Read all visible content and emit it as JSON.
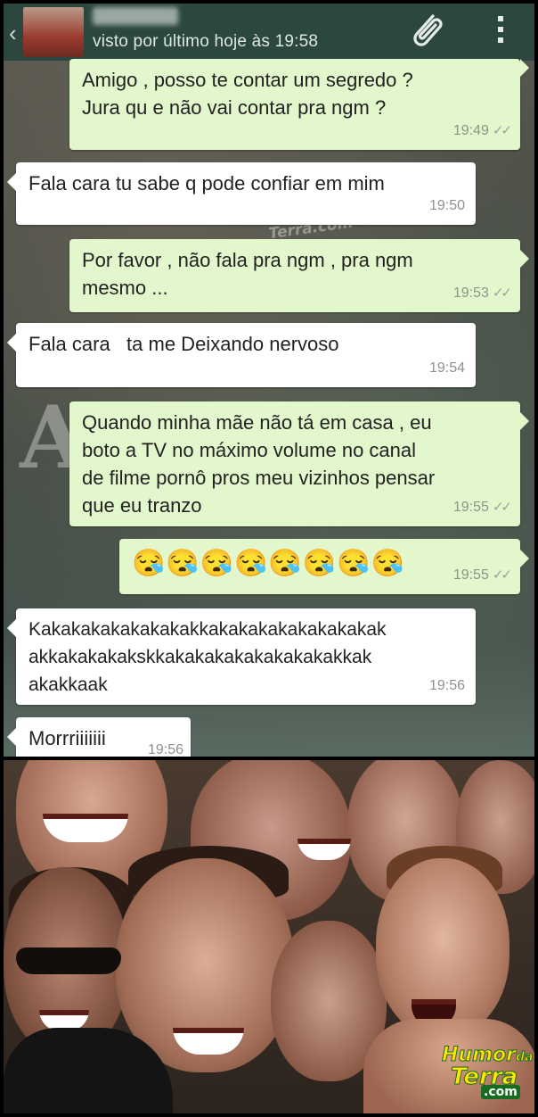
{
  "header": {
    "last_seen": "visto por último hoje às 19:58"
  },
  "messages": [
    {
      "direction": "out",
      "text": "Amigo , posso te contar um segredo ?\nJura qu e não vai contar pra ngm ?",
      "time": "19:49",
      "status": "read"
    },
    {
      "direction": "in",
      "text": "Fala cara tu sabe q pode confiar em mim",
      "time": "19:50"
    },
    {
      "direction": "out",
      "text": "Por favor , não fala pra ngm , pra ngm\nmesmo ...",
      "time": "19:53",
      "status": "read"
    },
    {
      "direction": "in",
      "text": "Fala cara   ta me Deixando nervoso",
      "time": "19:54"
    },
    {
      "direction": "out",
      "text": "Quando minha mãe não tá em casa , eu\nboto a TV no máximo volume no canal\nde filme pornô pros meu vizinhos pensar\nque eu tranzo",
      "time": "19:55",
      "status": "read"
    },
    {
      "direction": "out",
      "text": "😪😪😪😪😪😪😪😪",
      "time": "19:55",
      "status": "read"
    },
    {
      "direction": "in",
      "text": "Kakakakakakakakakkakakakakakakakakak\nakkakakakaksk​kakakakakakakakakakkak\nakakkaak",
      "time": "19:56"
    },
    {
      "direction": "in",
      "text": "Morrriiiiiii",
      "time": "19:56"
    }
  ],
  "bg_letter": "A",
  "watermark": {
    "line1": "Humor",
    "line2": "da",
    "line3": "Terra",
    "line4": ".com"
  },
  "colors": {
    "topbar": "#2c4740",
    "incoming": "#ffffff",
    "outgoing": "#e2f7cc"
  },
  "icons": {
    "back": "chevron-left-icon",
    "attach": "paperclip-icon",
    "menu": "overflow-menu-icon"
  }
}
